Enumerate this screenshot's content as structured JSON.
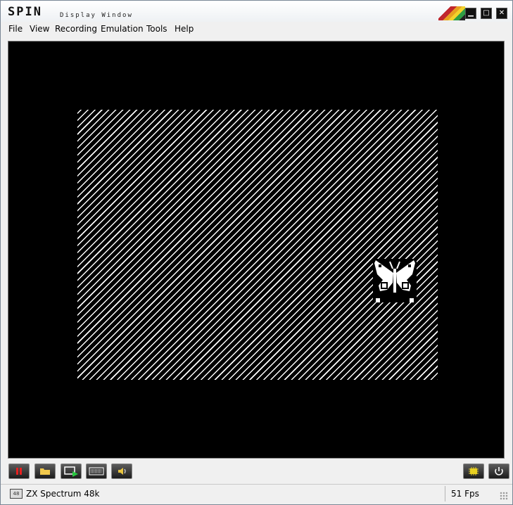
{
  "window": {
    "logo_text": "SPIN",
    "title": "Display Window",
    "controls": [
      "minimize-icon",
      "maximize-icon",
      "close-icon"
    ]
  },
  "menu": {
    "items": [
      "File",
      "View",
      "Recording",
      "Emulation",
      "Tools",
      "Help"
    ]
  },
  "toolbar": {
    "left_buttons": [
      "pause-icon",
      "open-folder-icon",
      "tape-play-icon",
      "keyboard-icon",
      "speaker-icon"
    ],
    "right_buttons": [
      "chip-icon",
      "power-icon"
    ]
  },
  "status": {
    "mode_badge": "48",
    "machine": "ZX Spectrum 48k",
    "fps": "51 Fps"
  },
  "colors": {
    "accent_stripes": [
      "#c0262d",
      "#e8a020",
      "#f3d22b",
      "#2f9e45"
    ],
    "border": "#000000",
    "paper_ink": "#ffffff"
  }
}
